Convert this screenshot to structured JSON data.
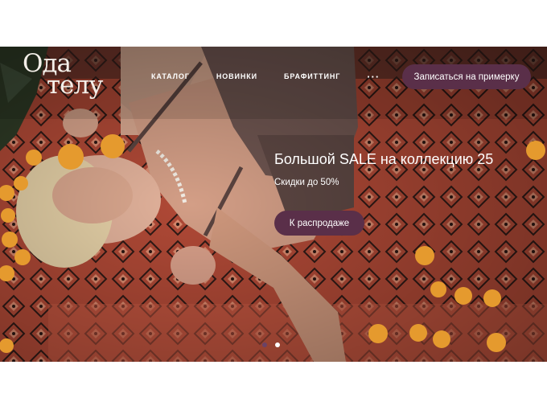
{
  "logo": {
    "line1": "Ода",
    "line2": "телу"
  },
  "nav": {
    "items": [
      {
        "label": "КАТАЛОГ"
      },
      {
        "label": "НОВИНКИ"
      },
      {
        "label": "БРАФИТТИНГ"
      }
    ],
    "more": "···"
  },
  "header": {
    "cta_label": "Записаться на примерку"
  },
  "promo": {
    "title": "Большой SALE на коллекцию 25",
    "subtitle": "Скидки до 50%",
    "cta_label": "К распродаже"
  },
  "slider": {
    "total": 2,
    "active_index": 0
  },
  "colors": {
    "accent": "#5a2f49",
    "active_dot": "#6a4266",
    "carpet": "#b24a38"
  }
}
